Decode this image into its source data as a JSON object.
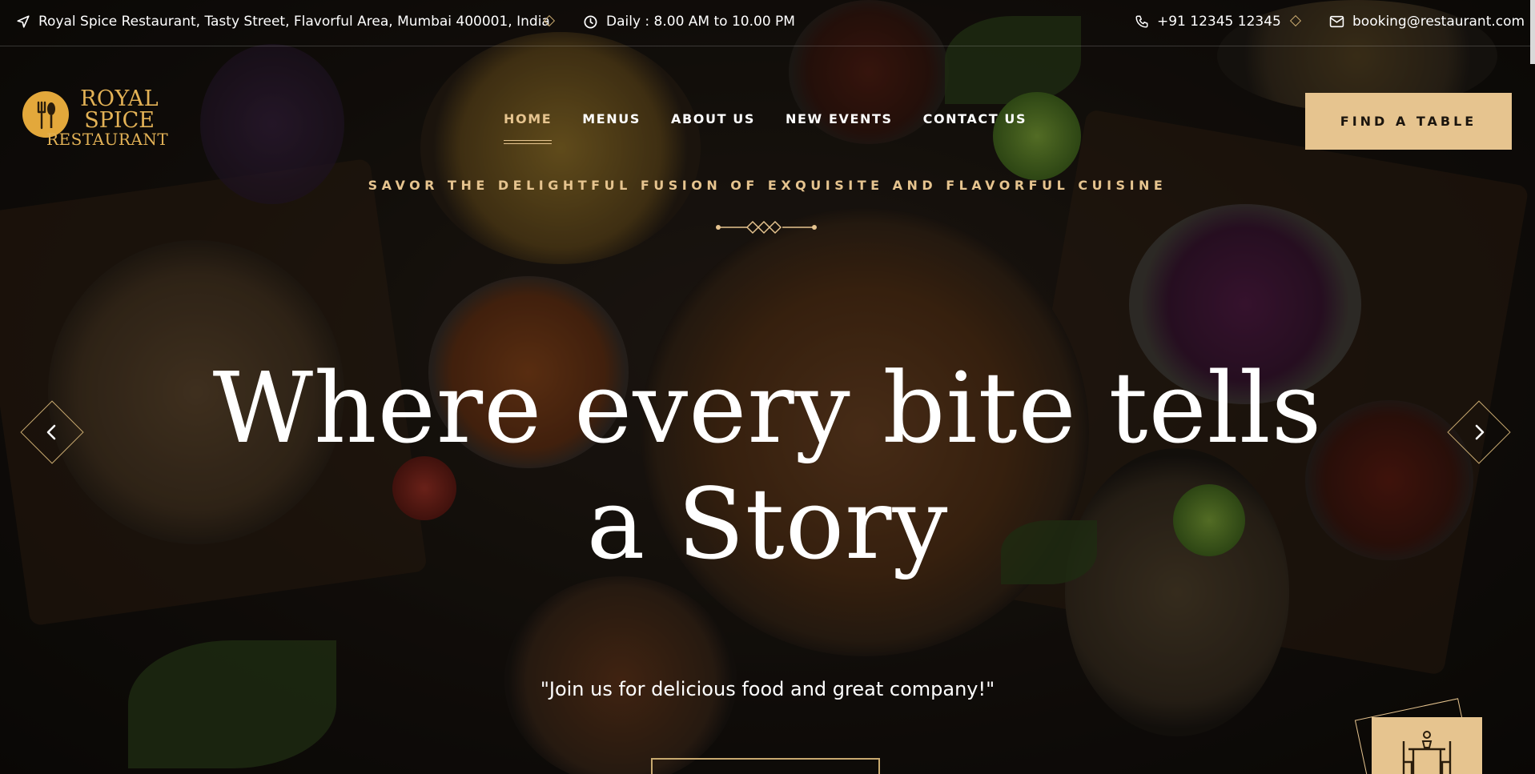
{
  "topbar": {
    "address": "Royal Spice Restaurant, Tasty Street, Flavorful Area, Mumbai 400001, India",
    "hours": "Daily : 8.00 AM to 10.00 PM",
    "phone": "+91 12345 12345",
    "email": "booking@restaurant.com"
  },
  "logo": {
    "line1": "ROYAL",
    "line2": "SPICE",
    "line3": "RESTAURANT"
  },
  "nav": {
    "items": [
      {
        "label": "HOME",
        "active": true
      },
      {
        "label": "MENUS",
        "active": false
      },
      {
        "label": "ABOUT US",
        "active": false
      },
      {
        "label": "NEW EVENTS",
        "active": false
      },
      {
        "label": "CONTACT US",
        "active": false
      }
    ],
    "cta": "FIND A TABLE"
  },
  "hero": {
    "tagline": "SAVOR THE DELIGHTFUL FUSION OF EXQUISITE AND FLAVORFUL CUISINE",
    "headline_line1": "Where every bite tells",
    "headline_line2": "a Story",
    "quote": "\"Join us for delicious food and great company!\""
  },
  "colors": {
    "accent": "#e6c48f",
    "logo": "#e3a83b",
    "background": "#0e0c0a"
  },
  "icons": [
    "location-arrow-icon",
    "clock-icon",
    "phone-icon",
    "mail-icon",
    "chevron-left-icon",
    "chevron-right-icon",
    "dining-table-icon"
  ]
}
